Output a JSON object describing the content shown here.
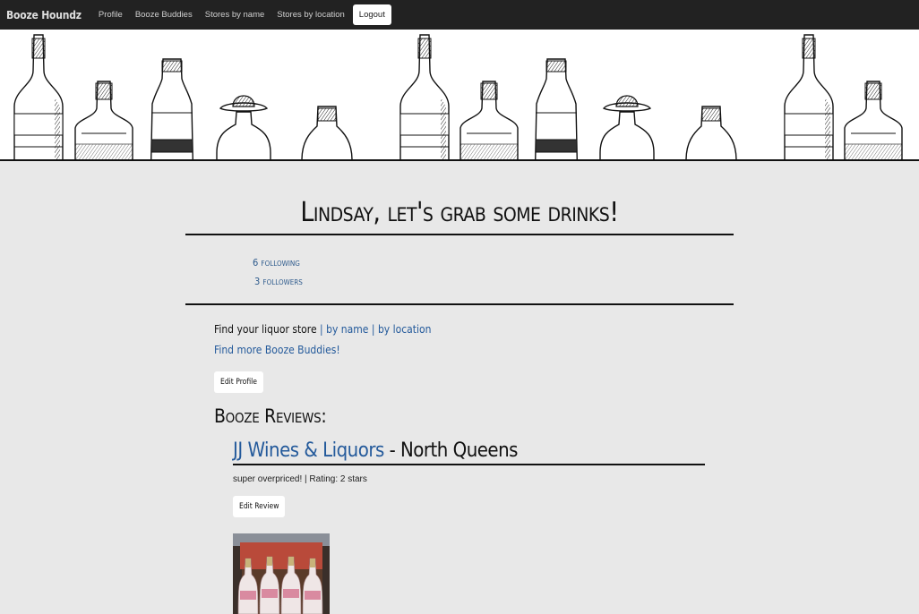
{
  "navbar": {
    "brand": "Booze Houndz",
    "links": [
      "Profile",
      "Booze Buddies",
      "Stores by name",
      "Stores by location"
    ],
    "logout": "Logout"
  },
  "profile": {
    "greeting": "Lindsay, let's grab some drinks!",
    "following": "6 following",
    "followers": "3 followers"
  },
  "find": {
    "prefix": "Find your liquor store",
    "sep": "|",
    "by_name": "by name",
    "by_location": "by location",
    "more_buddies": "Find more Booze Buddies!"
  },
  "edit_profile": "Edit Profile",
  "reviews_title": "Booze Reviews:",
  "reviews": [
    {
      "store": "JJ Wines & Liquors",
      "dash": " - ",
      "location": "North Queens",
      "text": "super overpriced! | Rating: 2 stars",
      "edit": "Edit Review"
    }
  ],
  "colors": {
    "navbar_bg": "#222222",
    "page_bg": "#e8e8e8",
    "link": "#245a9b"
  }
}
